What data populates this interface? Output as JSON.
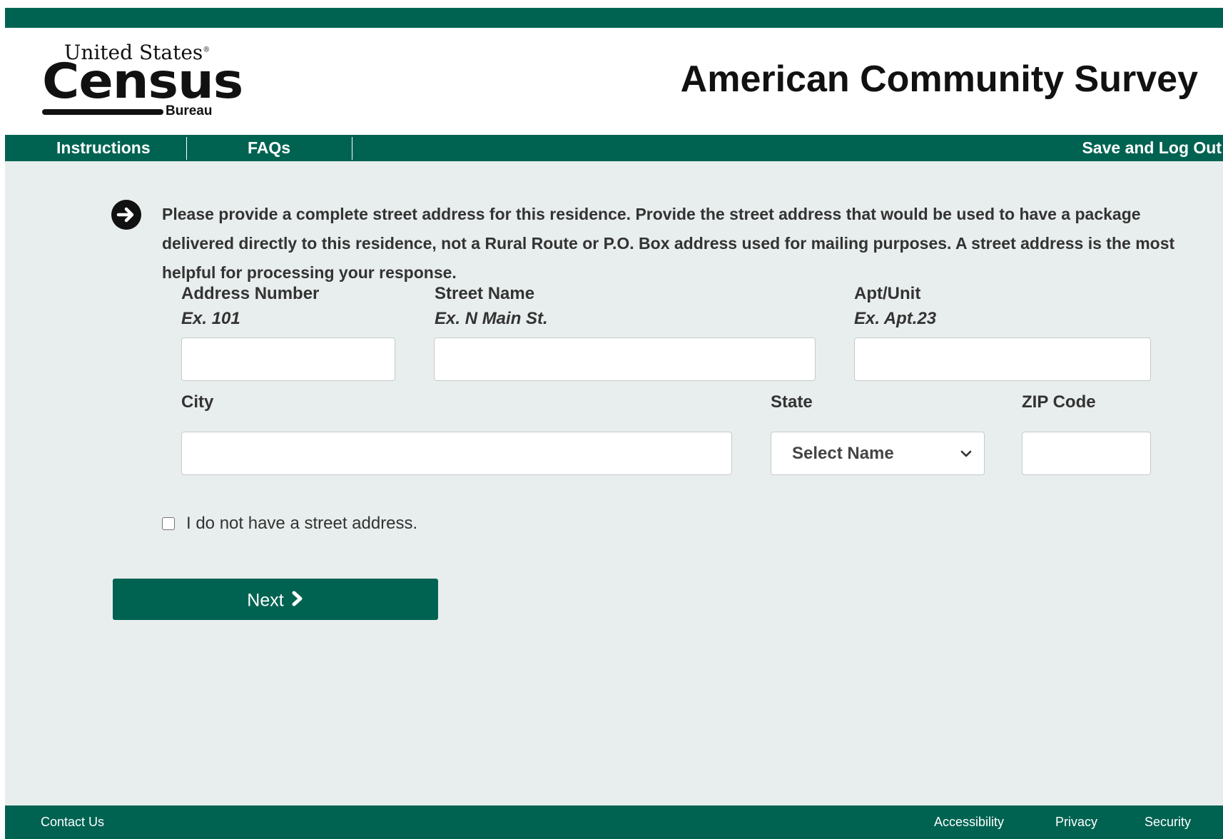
{
  "logo": {
    "line1": "United States",
    "registered": "®",
    "wordmark": "Census",
    "line3": "Bureau"
  },
  "header": {
    "title": "American Community Survey"
  },
  "nav": {
    "instructions": "Instructions",
    "faqs": "FAQs",
    "save_logout": "Save and Log Out"
  },
  "main": {
    "instruction_icon": "arrow-right-circle-icon",
    "instruction_text": "Please provide a complete street address for this residence. Provide the street address that would be used to have a package delivered directly to this residence, not a Rural Route or P.O. Box address used for mailing purposes. A street address is the most helpful for processing your response.",
    "fields": {
      "address_number": {
        "label": "Address Number",
        "example": "Ex. 101",
        "value": ""
      },
      "street_name": {
        "label": "Street Name",
        "example": "Ex. N Main St.",
        "value": ""
      },
      "apt_unit": {
        "label": "Apt/Unit",
        "example": "Ex. Apt.23",
        "value": ""
      },
      "city": {
        "label": "City",
        "value": ""
      },
      "state": {
        "label": "State",
        "selected": "Select Name"
      },
      "zip": {
        "label": "ZIP Code",
        "value": ""
      }
    },
    "no_street_checkbox": {
      "label": "I do not have a street address.",
      "checked": false
    },
    "next_button": {
      "label": "Next",
      "icon": "chevron-right-icon"
    }
  },
  "footer": {
    "contact": "Contact Us",
    "accessibility": "Accessibility",
    "privacy": "Privacy",
    "security": "Security"
  },
  "colors": {
    "brand_green": "#006352",
    "page_background": "#e8eeed",
    "text": "#333333"
  }
}
